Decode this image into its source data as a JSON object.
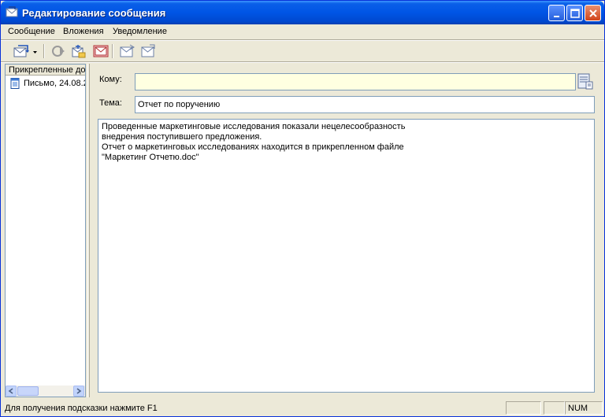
{
  "window": {
    "title": "Редактирование сообщения"
  },
  "menu": {
    "items": [
      "Сообщение",
      "Вложения",
      "Уведомление"
    ]
  },
  "left_panel": {
    "header": "Прикрепленные документы",
    "items": [
      {
        "label": "Письмо, 24.08.2"
      }
    ]
  },
  "form": {
    "to_label": "Кому:",
    "to_value": "",
    "subject_label": "Тема:",
    "subject_value": "Отчет по поручению",
    "body_lines": [
      "Проведенные маркетинговые исследования показали нецелесообразность",
      "внедрения поступившего предложения.",
      "Отчет о маркетинговых исследованиях находится в прикрепленном файле",
      "\"Маркетинг Отчетю.doc\""
    ]
  },
  "status": {
    "hint": "Для получения подсказки нажмите F1",
    "num": "NUM"
  },
  "colors": {
    "titlebar": "#0055e5",
    "to_field_bg": "#ffffe1"
  }
}
